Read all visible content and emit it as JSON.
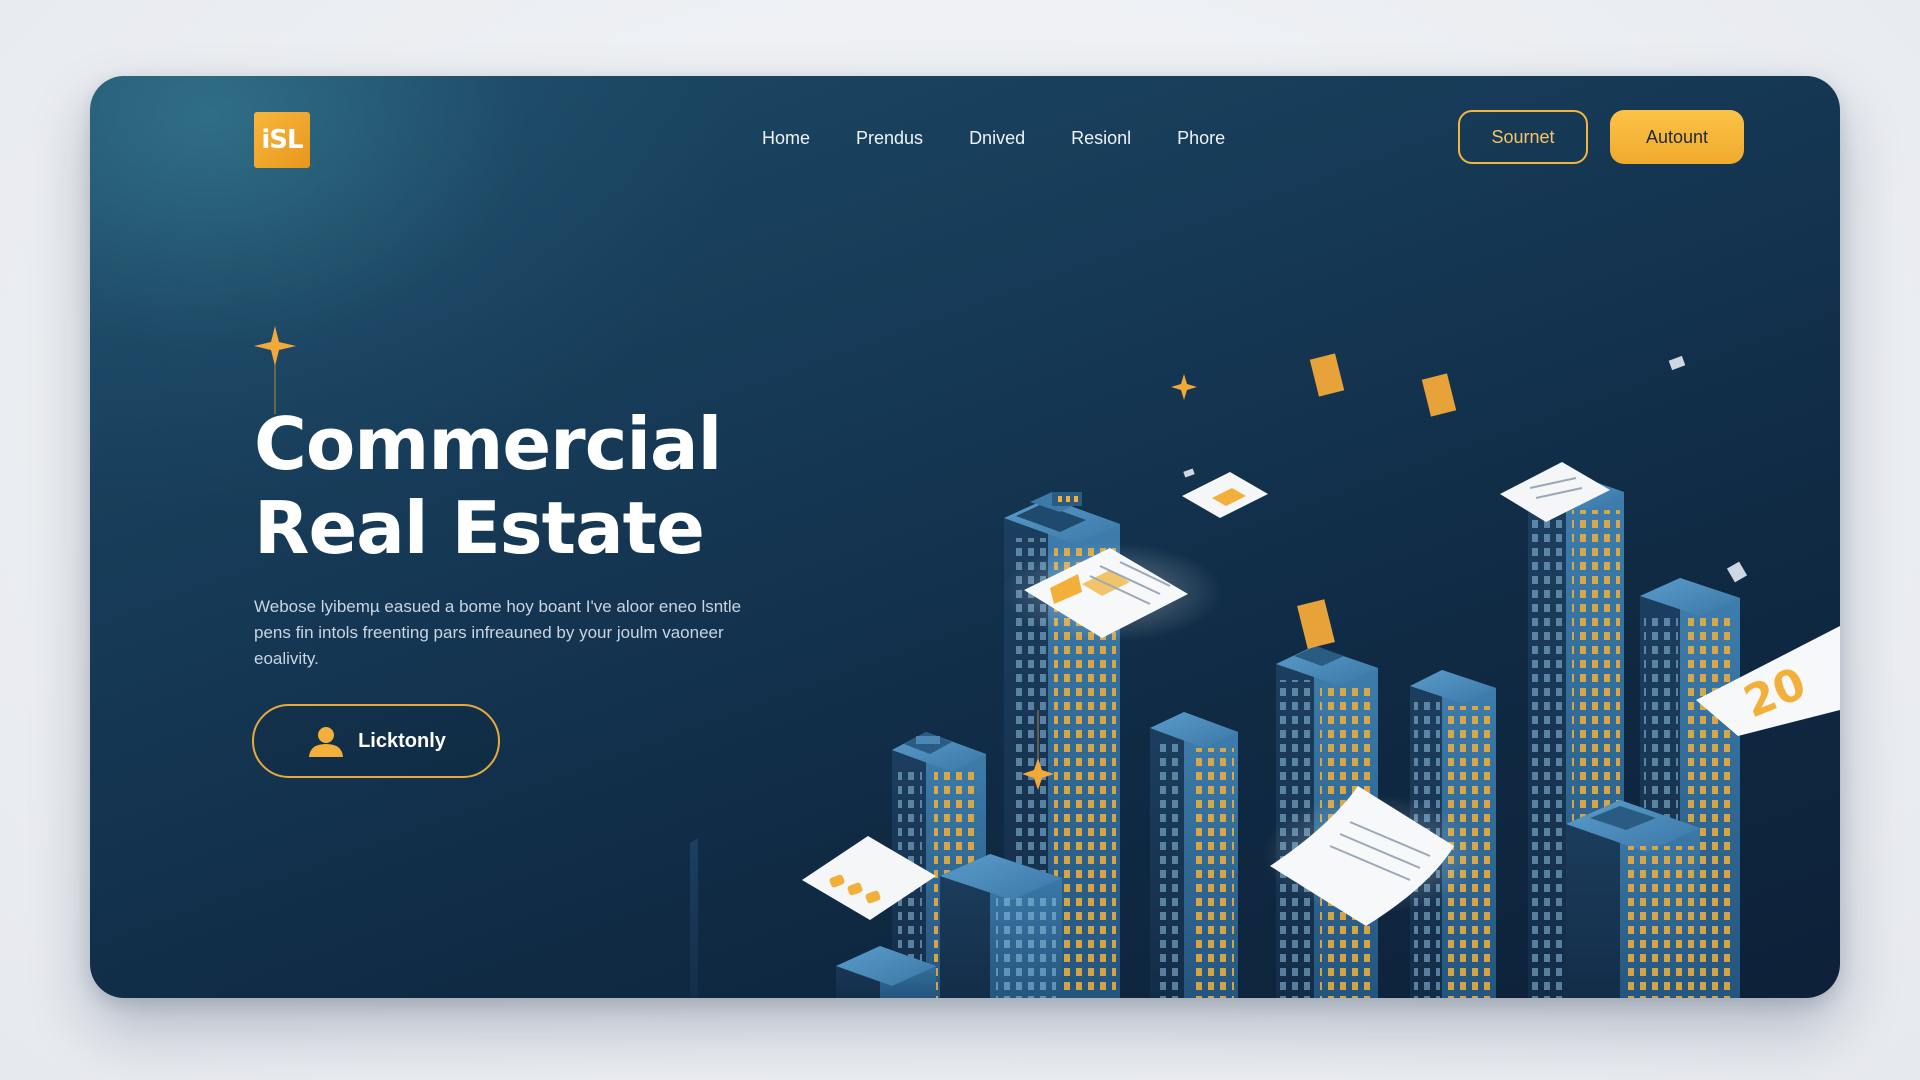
{
  "brand": {
    "logo_text": "iSL",
    "accent": "#f2b03a",
    "bg_dark": "#102b45"
  },
  "nav": {
    "items": [
      "Home",
      "Prendus",
      "Dnived",
      "Resionl",
      "Phore"
    ]
  },
  "header_buttons": {
    "outline_label": "Sournet",
    "filled_label": "Autount"
  },
  "hero": {
    "title_line1": "Commercial",
    "title_line2": "Real Estate",
    "description": "Webose lyibemµ easued a bome hoy boant I've aloor eneo lsntle pens fin intols freenting pars infreauned by your joulm vaoneer eoalivity.",
    "cta_label": "Licktonly",
    "cta_icon": "user-icon"
  },
  "illustration": {
    "badge_text": "20",
    "icons": [
      "skyscraper-icon",
      "document-icon",
      "sparkle-icon",
      "bar-chart-icon"
    ]
  }
}
